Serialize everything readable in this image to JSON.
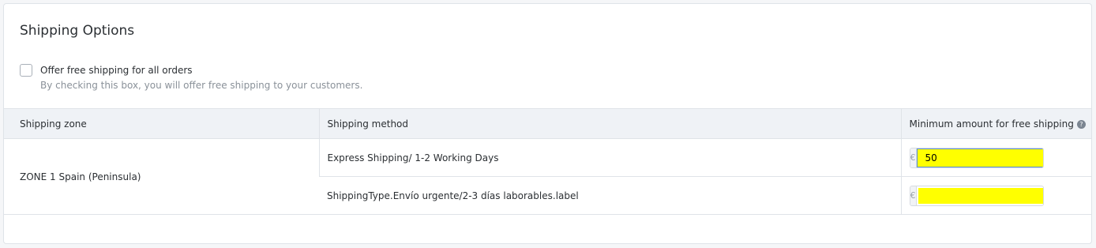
{
  "section": {
    "title": "Shipping Options"
  },
  "free_shipping": {
    "label": "Offer free shipping for all orders",
    "help": "By checking this box, you will offer free shipping to your customers.",
    "checked": false
  },
  "table": {
    "headers": {
      "zone": "Shipping zone",
      "method": "Shipping method",
      "minimum": "Minimum amount for free shipping"
    },
    "zone_name": "ZONE 1 Spain (Peninsula)",
    "rows": [
      {
        "method": "Express Shipping/ 1-2 Working Days",
        "currency": "€",
        "amount": "50"
      },
      {
        "method": "ShippingType.Envío urgente/2-3 días laborables.label",
        "currency": "€",
        "amount": ""
      }
    ]
  },
  "colors": {
    "highlight": "#ffff00",
    "focus_border": "#5b8fd6"
  },
  "icons": {
    "help": "question-circle-icon"
  }
}
